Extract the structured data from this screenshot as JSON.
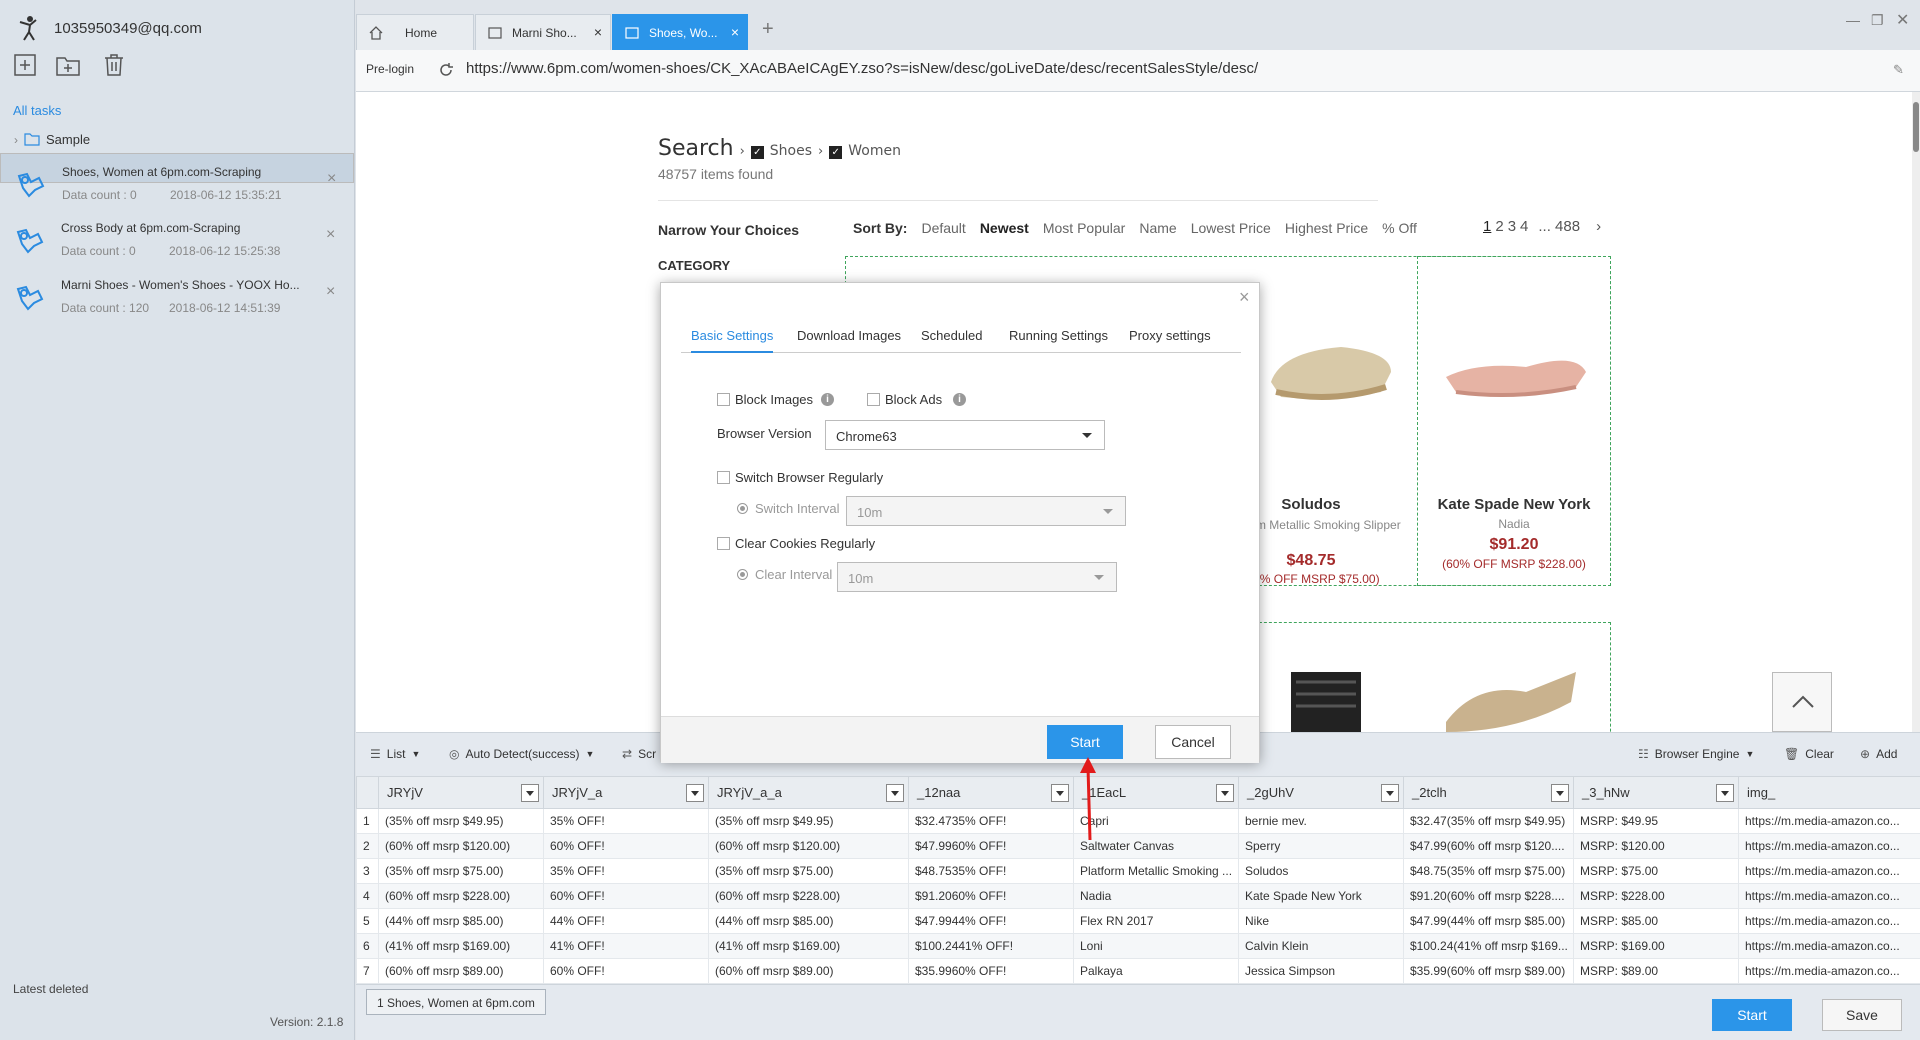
{
  "account": {
    "email": "1035950349@qq.com"
  },
  "sidebar": {
    "all_tasks": "All tasks",
    "folder": "Sample",
    "tasks": [
      {
        "name": "Shoes, Women at 6pm.com-Scraping",
        "count": "Data count : 0",
        "date": "2018-06-12 15:35:21"
      },
      {
        "name": "Cross Body at 6pm.com-Scraping",
        "count": "Data count : 0",
        "date": "2018-06-12 15:25:38"
      },
      {
        "name": "Marni Shoes - Women's Shoes - YOOX Ho...",
        "count": "Data count : 120",
        "date": "2018-06-12 14:51:39"
      }
    ],
    "latest_deleted": "Latest deleted",
    "version": "Version: 2.1.8"
  },
  "tabs": [
    {
      "label": "Home"
    },
    {
      "label": "Marni Sho..."
    },
    {
      "label": "Shoes, Wo..."
    }
  ],
  "address": {
    "prelogin": "Pre-login",
    "url": "https://www.6pm.com/women-shoes/CK_XAcABAeICAgEY.zso?s=isNew/desc/goLiveDate/desc/recentSalesStyle/desc/"
  },
  "page": {
    "search": "Search",
    "crumb1": "Shoes",
    "crumb2": "Women",
    "found": "48757 items found",
    "narrow": "Narrow Your Choices",
    "category": "CATEGORY",
    "sort_by": "Sort By:",
    "sorts": [
      "Default",
      "Newest",
      "Most Popular",
      "Name",
      "Lowest Price",
      "Highest Price",
      "% Off"
    ],
    "pages": [
      "1",
      "2",
      "3",
      "4",
      "... 488"
    ],
    "products": [
      {
        "brand": "Soludos",
        "sub": "Platform Metallic Smoking Slipper",
        "price": "$48.75",
        "off": "(35% OFF MSRP $75.00)"
      },
      {
        "brand": "Kate Spade New York",
        "sub": "Nadia",
        "price": "$91.20",
        "off": "(60% OFF MSRP $228.00)"
      }
    ]
  },
  "dialog": {
    "tabs": [
      "Basic Settings",
      "Download Images",
      "Scheduled",
      "Running Settings",
      "Proxy settings"
    ],
    "block_images": "Block Images",
    "block_ads": "Block Ads",
    "browser_version_label": "Browser Version",
    "browser_version": "Chrome63",
    "switch_browser": "Switch Browser Regularly",
    "switch_interval_label": "Switch Interval",
    "switch_interval": "10m",
    "clear_cookies": "Clear Cookies Regularly",
    "clear_interval_label": "Clear Interval",
    "clear_interval": "10m",
    "start": "Start",
    "cancel": "Cancel"
  },
  "toolbar": {
    "list": "List",
    "auto_detect": "Auto Detect(success)",
    "scroll": "Scr",
    "browser_engine": "Browser Engine",
    "clear": "Clear",
    "add": "Add"
  },
  "grid": {
    "headers": [
      "JRYjV",
      "JRYjV_a",
      "JRYjV_a_a",
      "_12naa",
      "_1EacL",
      "_2gUhV",
      "_2tclh",
      "_3_hNw",
      "img_"
    ],
    "rows": [
      [
        "1",
        "(35% off msrp $49.95)",
        "35% OFF!",
        "(35% off msrp $49.95)",
        "$32.4735% OFF!",
        "Capri",
        "bernie mev.",
        "$32.47(35% off msrp $49.95)",
        "MSRP: $49.95",
        "https://m.media-amazon.co..."
      ],
      [
        "2",
        "(60% off msrp $120.00)",
        "60% OFF!",
        "(60% off msrp $120.00)",
        "$47.9960% OFF!",
        "Saltwater Canvas",
        "Sperry",
        "$47.99(60% off msrp $120....",
        "MSRP: $120.00",
        "https://m.media-amazon.co..."
      ],
      [
        "3",
        "(35% off msrp $75.00)",
        "35% OFF!",
        "(35% off msrp $75.00)",
        "$48.7535% OFF!",
        "Platform Metallic Smoking ...",
        "Soludos",
        "$48.75(35% off msrp $75.00)",
        "MSRP: $75.00",
        "https://m.media-amazon.co..."
      ],
      [
        "4",
        "(60% off msrp $228.00)",
        "60% OFF!",
        "(60% off msrp $228.00)",
        "$91.2060% OFF!",
        "Nadia",
        "Kate Spade New York",
        "$91.20(60% off msrp $228....",
        "MSRP: $228.00",
        "https://m.media-amazon.co..."
      ],
      [
        "5",
        "(44% off msrp $85.00)",
        "44% OFF!",
        "(44% off msrp $85.00)",
        "$47.9944% OFF!",
        "Flex RN 2017",
        "Nike",
        "$47.99(44% off msrp $85.00)",
        "MSRP: $85.00",
        "https://m.media-amazon.co..."
      ],
      [
        "6",
        "(41% off msrp $169.00)",
        "41% OFF!",
        "(41% off msrp $169.00)",
        "$100.2441% OFF!",
        "Loni",
        "Calvin Klein",
        "$100.24(41% off msrp $169...",
        "MSRP: $169.00",
        "https://m.media-amazon.co..."
      ],
      [
        "7",
        "(60% off msrp $89.00)",
        "60% OFF!",
        "(60% off msrp $89.00)",
        "$35.9960% OFF!",
        "Palkaya",
        "Jessica Simpson",
        "$35.99(60% off msrp $89.00)",
        "MSRP: $89.00",
        "https://m.media-amazon.co..."
      ]
    ]
  },
  "bottom": {
    "task_tab": "1 Shoes, Women at 6pm.com",
    "start": "Start",
    "save": "Save"
  }
}
